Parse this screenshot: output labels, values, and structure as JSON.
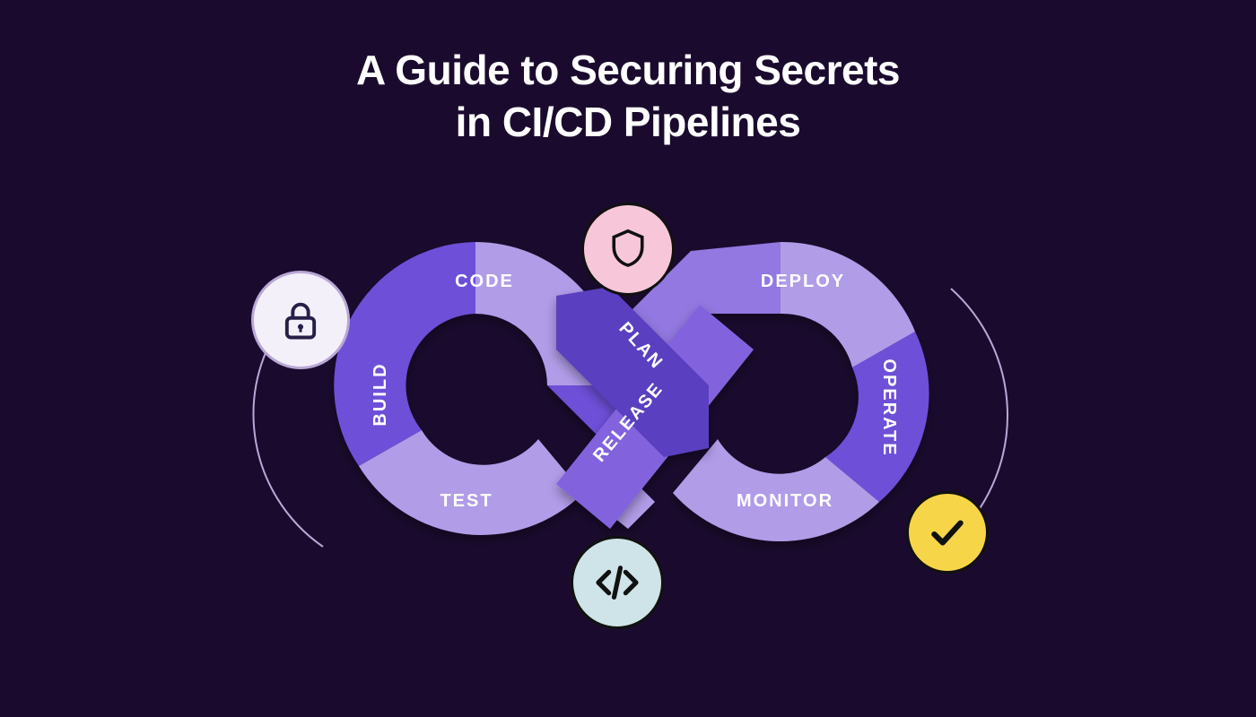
{
  "title_line1": "A Guide to Securing Secrets",
  "title_line2": "in CI/CD Pipelines",
  "stages": {
    "plan": "PLAN",
    "code": "CODE",
    "build": "BUILD",
    "test": "TEST",
    "release": "RELEASE",
    "deploy": "DEPLOY",
    "operate": "OPERATE",
    "monitor": "MONITOR"
  },
  "colors": {
    "bg": "#1a0b2e",
    "light_purple": "#b19ce8",
    "mid_purple": "#9278e0",
    "deep_purple": "#6e4fd8",
    "dark_purple": "#5a3fc0",
    "badge_shield_bg": "#f7c7d9",
    "badge_lock_bg": "#f4f0fa",
    "badge_code_bg": "#cfe4e8",
    "badge_check_bg": "#f7d548"
  },
  "badges": {
    "shield": "shield-icon",
    "lock": "lock-icon",
    "code": "code-icon",
    "check": "check-icon"
  }
}
